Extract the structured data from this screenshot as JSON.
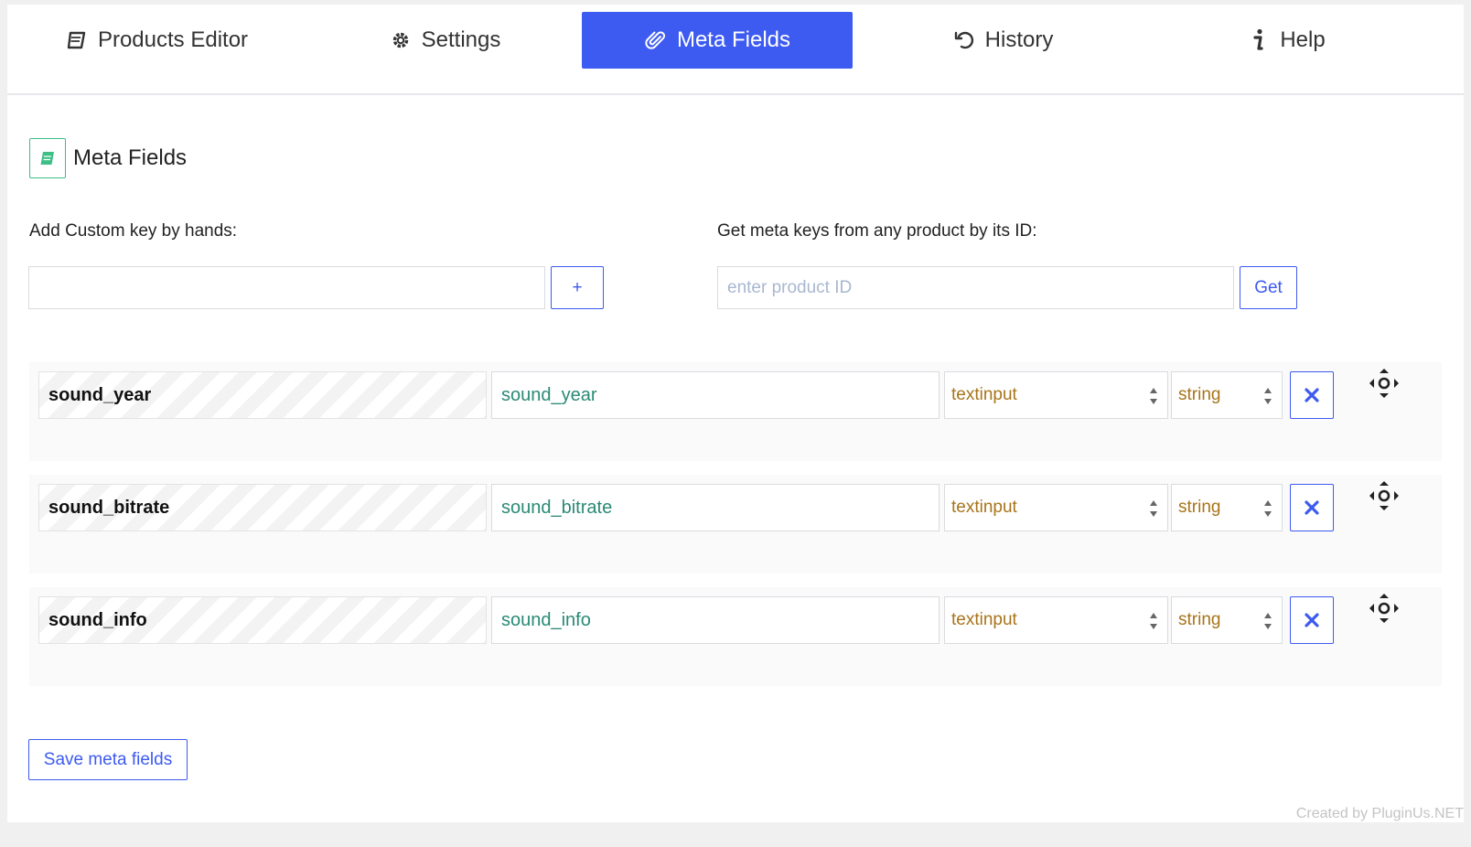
{
  "tabs": [
    {
      "label": "Products Editor",
      "icon": "book-icon",
      "active": false
    },
    {
      "label": "Settings",
      "icon": "gear-icon",
      "active": false
    },
    {
      "label": "Meta Fields",
      "icon": "paperclip-icon",
      "active": true
    },
    {
      "label": "History",
      "icon": "undo-icon",
      "active": false
    },
    {
      "label": "Help",
      "icon": "info-icon",
      "active": false
    }
  ],
  "section": {
    "title": "Meta Fields",
    "icon": "book-icon",
    "accent": "#3dbf86"
  },
  "custom_key": {
    "label": "Add Custom key by hands:",
    "value": "",
    "placeholder": "",
    "add_label": "+"
  },
  "product_lookup": {
    "label": "Get meta keys from any product by its ID:",
    "value": "",
    "placeholder": "enter product ID",
    "get_label": "Get"
  },
  "rows": [
    {
      "key": "sound_year",
      "title": "sound_year",
      "field_type": "textinput",
      "value_type": "string"
    },
    {
      "key": "sound_bitrate",
      "title": "sound_bitrate",
      "field_type": "textinput",
      "value_type": "string"
    },
    {
      "key": "sound_info",
      "title": "sound_info",
      "field_type": "textinput",
      "value_type": "string"
    }
  ],
  "save_label": "Save meta fields",
  "footer": "Created by PluginUs.NET",
  "colors": {
    "primary": "#3d5af1",
    "title_text": "#2a8a76",
    "select_text": "#a8741a"
  }
}
